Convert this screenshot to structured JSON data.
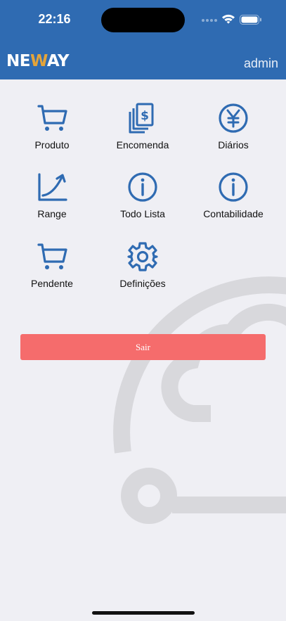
{
  "status_bar": {
    "time": "22:16"
  },
  "header": {
    "logo": {
      "part1": "NE",
      "part2": "W",
      "part3": "AY"
    },
    "user": "admin"
  },
  "menu": {
    "items": [
      {
        "label": "Produto",
        "icon": "cart-icon"
      },
      {
        "label": "Encomenda",
        "icon": "dollar-docs-icon"
      },
      {
        "label": "Diários",
        "icon": "yen-circle-icon"
      },
      {
        "label": "Range",
        "icon": "trend-arrow-icon"
      },
      {
        "label": "Todo Lista",
        "icon": "info-icon"
      },
      {
        "label": "Contabilidade",
        "icon": "info-icon"
      },
      {
        "label": "Pendente",
        "icon": "cart-icon"
      },
      {
        "label": "Definições",
        "icon": "gear-icon"
      }
    ]
  },
  "logout_button": "Sair",
  "colors": {
    "header": "#2f6bb2",
    "icon": "#2f6bb2",
    "logout": "#f56c6c",
    "background": "#efeff4"
  }
}
